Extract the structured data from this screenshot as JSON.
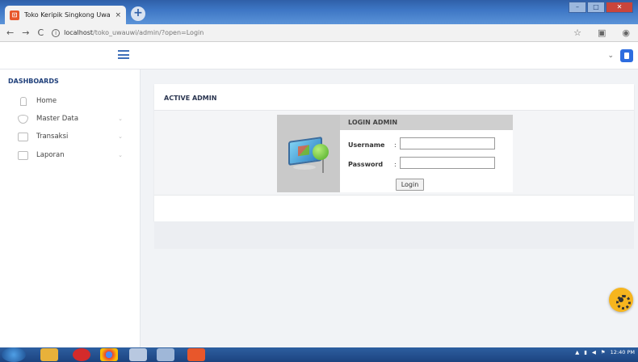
{
  "browser": {
    "tab_title": "Toko Keripik Singkong Uwa Uwi",
    "tab_close": "×",
    "new_tab": "+",
    "back": "←",
    "forward": "→",
    "reload": "C",
    "url_host": "localhost",
    "url_path": "/toko_uwauwi/admin/?open=Login",
    "bookmark_icon": "star-icon",
    "extension_icon": "extension-icon",
    "profile_icon": "profile-icon"
  },
  "header": {
    "menu_icon": "hamburger-icon",
    "chevron": "⌄",
    "badge_icon": "document-icon",
    "accent": "#2d6cdf"
  },
  "sidebar": {
    "heading": "DASHBOARDS",
    "items": [
      {
        "label": "Home",
        "icon": "home-icon"
      },
      {
        "label": "Master Data",
        "icon": "gem-icon",
        "chevron": "⌄"
      },
      {
        "label": "Transaksi",
        "icon": "wallet-icon",
        "chevron": "⌄"
      },
      {
        "label": "Laporan",
        "icon": "report-icon",
        "chevron": "⌄"
      }
    ]
  },
  "main": {
    "card_title": "ACTIVE ADMIN",
    "login": {
      "header": "LOGIN ADMIN",
      "username_label": "Username",
      "password_label": "Password",
      "colon": ":",
      "username_value": "",
      "password_value": "",
      "button_label": "Login"
    },
    "fab_icon": "gear-icon",
    "fab_color": "#f6b51e"
  },
  "taskbar": {
    "time": "12:40 PM"
  }
}
